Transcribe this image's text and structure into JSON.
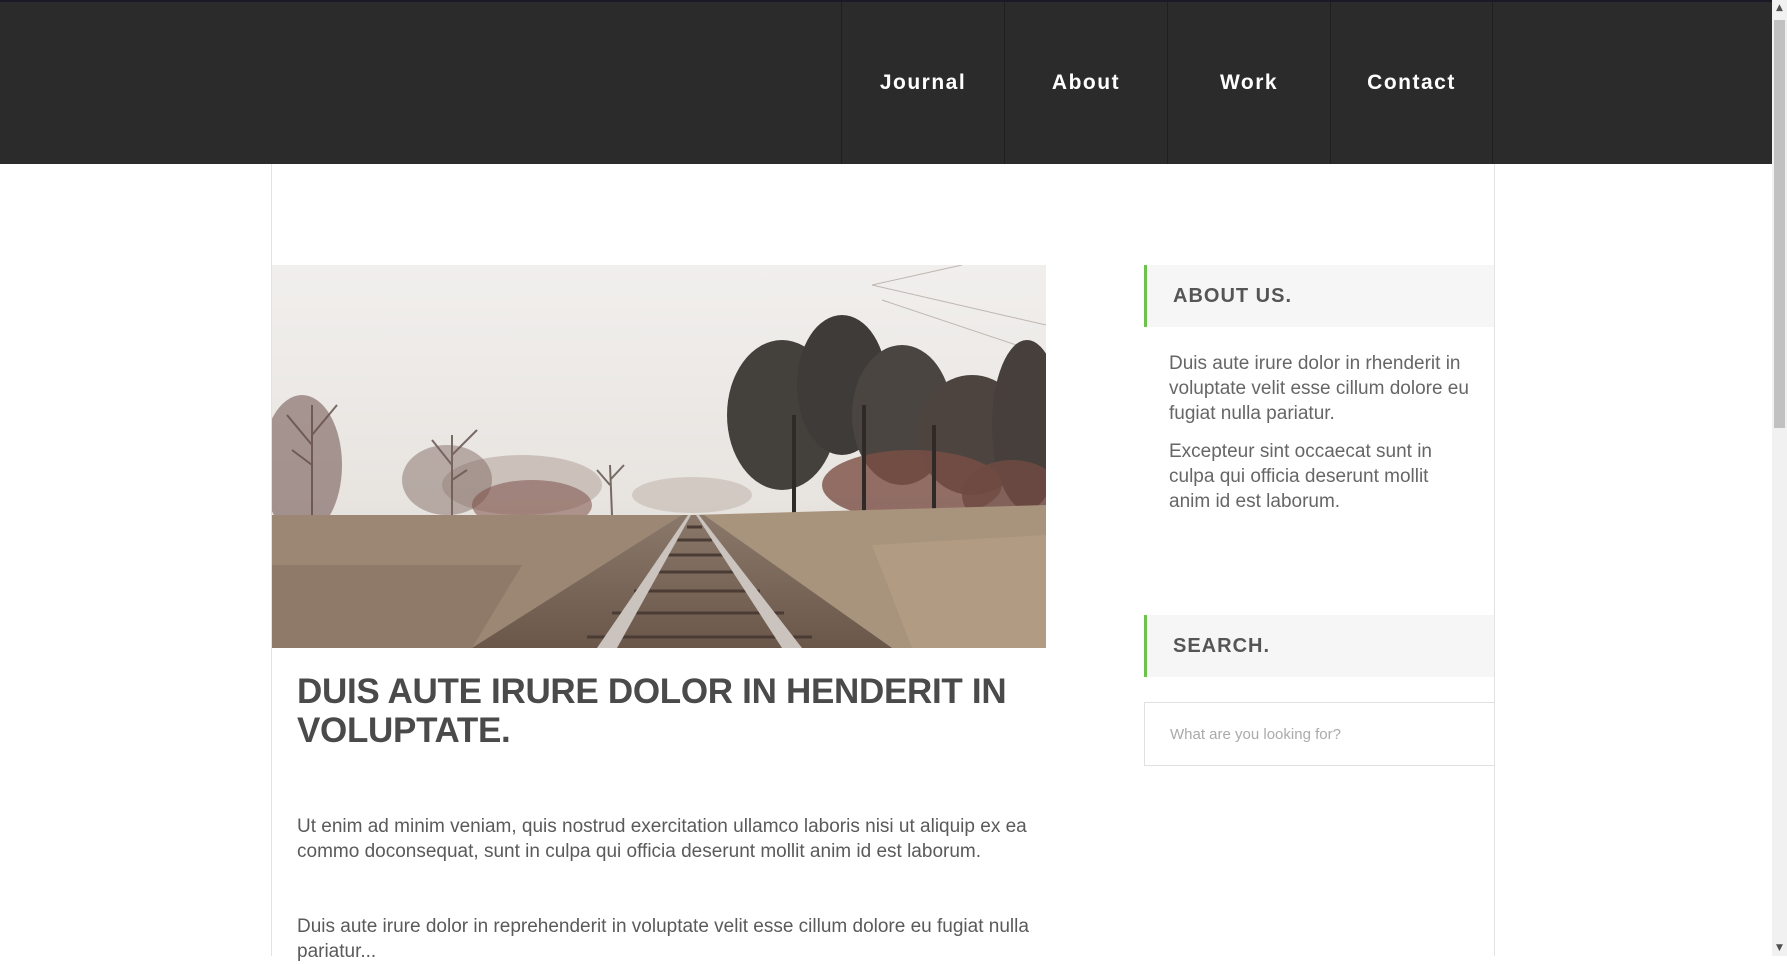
{
  "nav": {
    "items": [
      {
        "label": "Journal"
      },
      {
        "label": "About"
      },
      {
        "label": "Work"
      },
      {
        "label": "Contact"
      }
    ]
  },
  "post": {
    "title": "DUIS AUTE IRURE DOLOR IN HENDERIT IN VOLUPTATE.",
    "paragraphs": [
      "Ut enim ad minim veniam, quis nostrud exercitation ullamco laboris nisi ut aliquip ex ea commo doconsequat, sunt in culpa qui officia deserunt mollit anim id est laborum.",
      "Duis aute irure dolor in reprehenderit in voluptate velit esse cillum dolore eu fugiat nulla pariatur..."
    ]
  },
  "sidebar": {
    "about": {
      "title": "ABOUT US.",
      "paragraphs": [
        "Duis aute irure dolor in rhenderit in voluptate velit esse cillum dolore eu fugiat nulla pariatur.",
        "Excepteur sint occaecat sunt in culpa qui officia deserunt mollit anim id est laborum."
      ]
    },
    "search": {
      "title": "SEARCH.",
      "placeholder": "What are you looking for?"
    }
  },
  "colors": {
    "header_bg": "#2b2b2b",
    "accent": "#6cc24a",
    "widget_bg": "#f6f6f6"
  },
  "icons": {
    "scroll_up": "▲",
    "scroll_down": "▼"
  }
}
